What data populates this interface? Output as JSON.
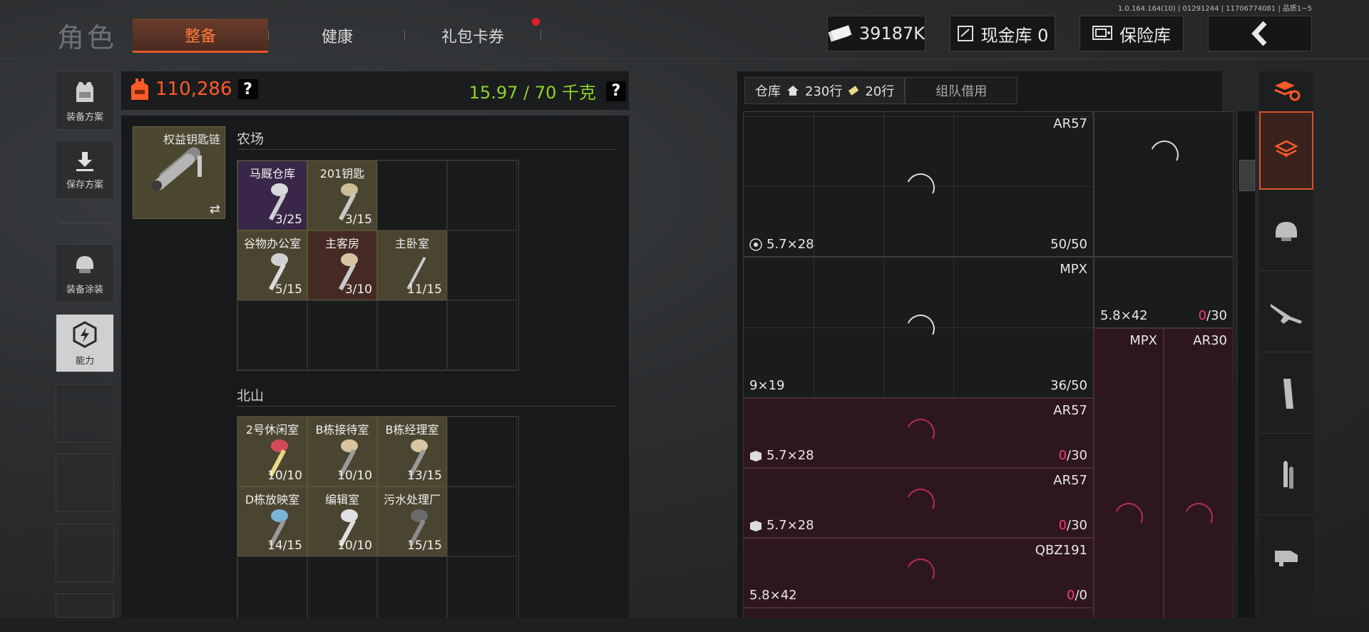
{
  "version": "1.0.164.164(10) | 01291244 | 11706774081 | 品质1~5",
  "header": {
    "title": "角色",
    "tabs": [
      {
        "label": "整备",
        "active": true
      },
      {
        "label": "健康",
        "active": false
      },
      {
        "label": "礼包卡券",
        "active": false,
        "notification": true
      }
    ],
    "currency": "39187K",
    "cash_vault": "现金库 0",
    "insurance": "保险库",
    "back_icon": "chevron-left-icon"
  },
  "sidebar": {
    "items": [
      {
        "label": "装备方案",
        "icon": "vest-icon"
      },
      {
        "label": "保存方案",
        "icon": "download-icon"
      },
      {
        "label": "装备涂装",
        "icon": "helmet-icon"
      },
      {
        "label": "能力",
        "icon": "lightning-icon"
      }
    ]
  },
  "equipment": {
    "value": "110,286",
    "help": "?",
    "weight": "15.97 / 70 千克",
    "keychain_label": "权益钥匙链",
    "swap_icon": "⇄"
  },
  "sections": [
    {
      "title": "农场",
      "keys": [
        {
          "name": "马厩仓库",
          "count": "3/25",
          "color": "#3a2648"
        },
        {
          "name": "201钥匙",
          "count": "3/15",
          "color": "#4a4530"
        },
        {
          "name": "谷物办公室",
          "count": "5/15",
          "color": "#4a4530"
        },
        {
          "name": "主客房",
          "count": "3/10",
          "color": "#452a24"
        },
        {
          "name": "主卧室",
          "count": "11/15",
          "color": "#4a4530"
        }
      ]
    },
    {
      "title": "北山",
      "keys": [
        {
          "name": "2号休闲室",
          "count": "10/10",
          "color": "#4a4530"
        },
        {
          "name": "B栋接待室",
          "count": "10/10",
          "color": "#4a4530"
        },
        {
          "name": "B栋经理室",
          "count": "13/15",
          "color": "#4a4530"
        },
        {
          "name": "D栋放映室",
          "count": "14/15",
          "color": "#4a4530"
        },
        {
          "name": "编辑室",
          "count": "10/10",
          "color": "#4a4530"
        },
        {
          "name": "污水处理厂",
          "count": "15/15",
          "color": "#4a4530"
        }
      ]
    }
  ],
  "warehouse": {
    "tab_label": "仓库",
    "rows_home": "230行",
    "rows_ticket": "20行",
    "team_tab": "组队借用",
    "items": [
      {
        "name": "AR57",
        "ammo": "5.7×28",
        "cap_now": "50",
        "cap_max": "/50",
        "zero": false
      },
      {
        "name": "MPX",
        "ammo": "9×19",
        "cap_now": "36",
        "cap_max": "/50",
        "zero": false
      },
      {
        "name": "",
        "ammo": "5.8×42",
        "cap_now": "0",
        "cap_max": "/30",
        "zero": true
      },
      {
        "name": "MPX",
        "ammo": "",
        "cap_now": "",
        "cap_max": "",
        "zero": false
      },
      {
        "name": "AR30",
        "ammo": "",
        "cap_now": "",
        "cap_max": "",
        "zero": false
      },
      {
        "name": "AR57",
        "ammo": "5.7×28",
        "cap_now": "0",
        "cap_max": "/30",
        "zero": true
      },
      {
        "name": "AR57",
        "ammo": "5.7×28",
        "cap_now": "0",
        "cap_max": "/30",
        "zero": true
      },
      {
        "name": "QBZ191",
        "ammo": "5.8×42",
        "cap_now": "0",
        "cap_max": "/0",
        "zero": true
      }
    ]
  },
  "categories": [
    {
      "icon": "stack-refresh-icon"
    },
    {
      "icon": "stack-icon",
      "active": true
    },
    {
      "icon": "helmet-icon"
    },
    {
      "icon": "rifle-icon"
    },
    {
      "icon": "magazine-icon"
    },
    {
      "icon": "bullet-icon"
    },
    {
      "icon": "scope-icon"
    }
  ]
}
